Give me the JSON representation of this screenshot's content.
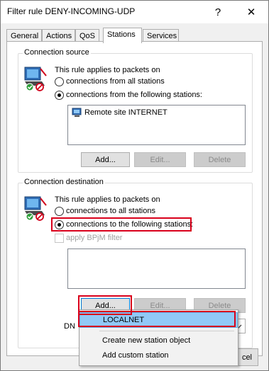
{
  "window": {
    "title": "Filter rule DENY-INCOMING-UDP",
    "help_glyph": "?",
    "close_glyph": "✕"
  },
  "tabs": [
    {
      "label": "General",
      "active": false
    },
    {
      "label": "Actions",
      "active": false
    },
    {
      "label": "QoS",
      "active": false
    },
    {
      "label": "Stations",
      "active": true
    },
    {
      "label": "Services",
      "active": false
    }
  ],
  "source": {
    "title": "Connection source",
    "intro": "This rule applies to packets on",
    "option_all": "connections from all stations",
    "option_following": "connections from the following stations:",
    "selected": "following",
    "stations": [
      {
        "label": "Remote site INTERNET",
        "icon": "remote-site-icon"
      }
    ],
    "buttons": {
      "add": "Add...",
      "edit": "Edit...",
      "delete": "Delete"
    }
  },
  "destination": {
    "title": "Connection destination",
    "intro": "This rule applies to packets on",
    "option_all": "connections to all stations",
    "option_following": "connections to the following stations:",
    "selected": "following",
    "bpjm_label": "apply BPjM filter",
    "stations": [],
    "buttons": {
      "add": "Add...",
      "edit": "Edit...",
      "delete": "Delete"
    },
    "dns_label_partial": "DN"
  },
  "dropdown_menu": {
    "items": [
      "LOCALNET",
      "Create new station object",
      "Add custom station"
    ],
    "selected": "LOCALNET"
  },
  "footer": {
    "cancel_partial": "cel"
  },
  "colors": {
    "highlight": "#d9001b",
    "menu_selection": "#91c9f7",
    "panel": "#ffffff",
    "window": "#f0f0f0"
  }
}
